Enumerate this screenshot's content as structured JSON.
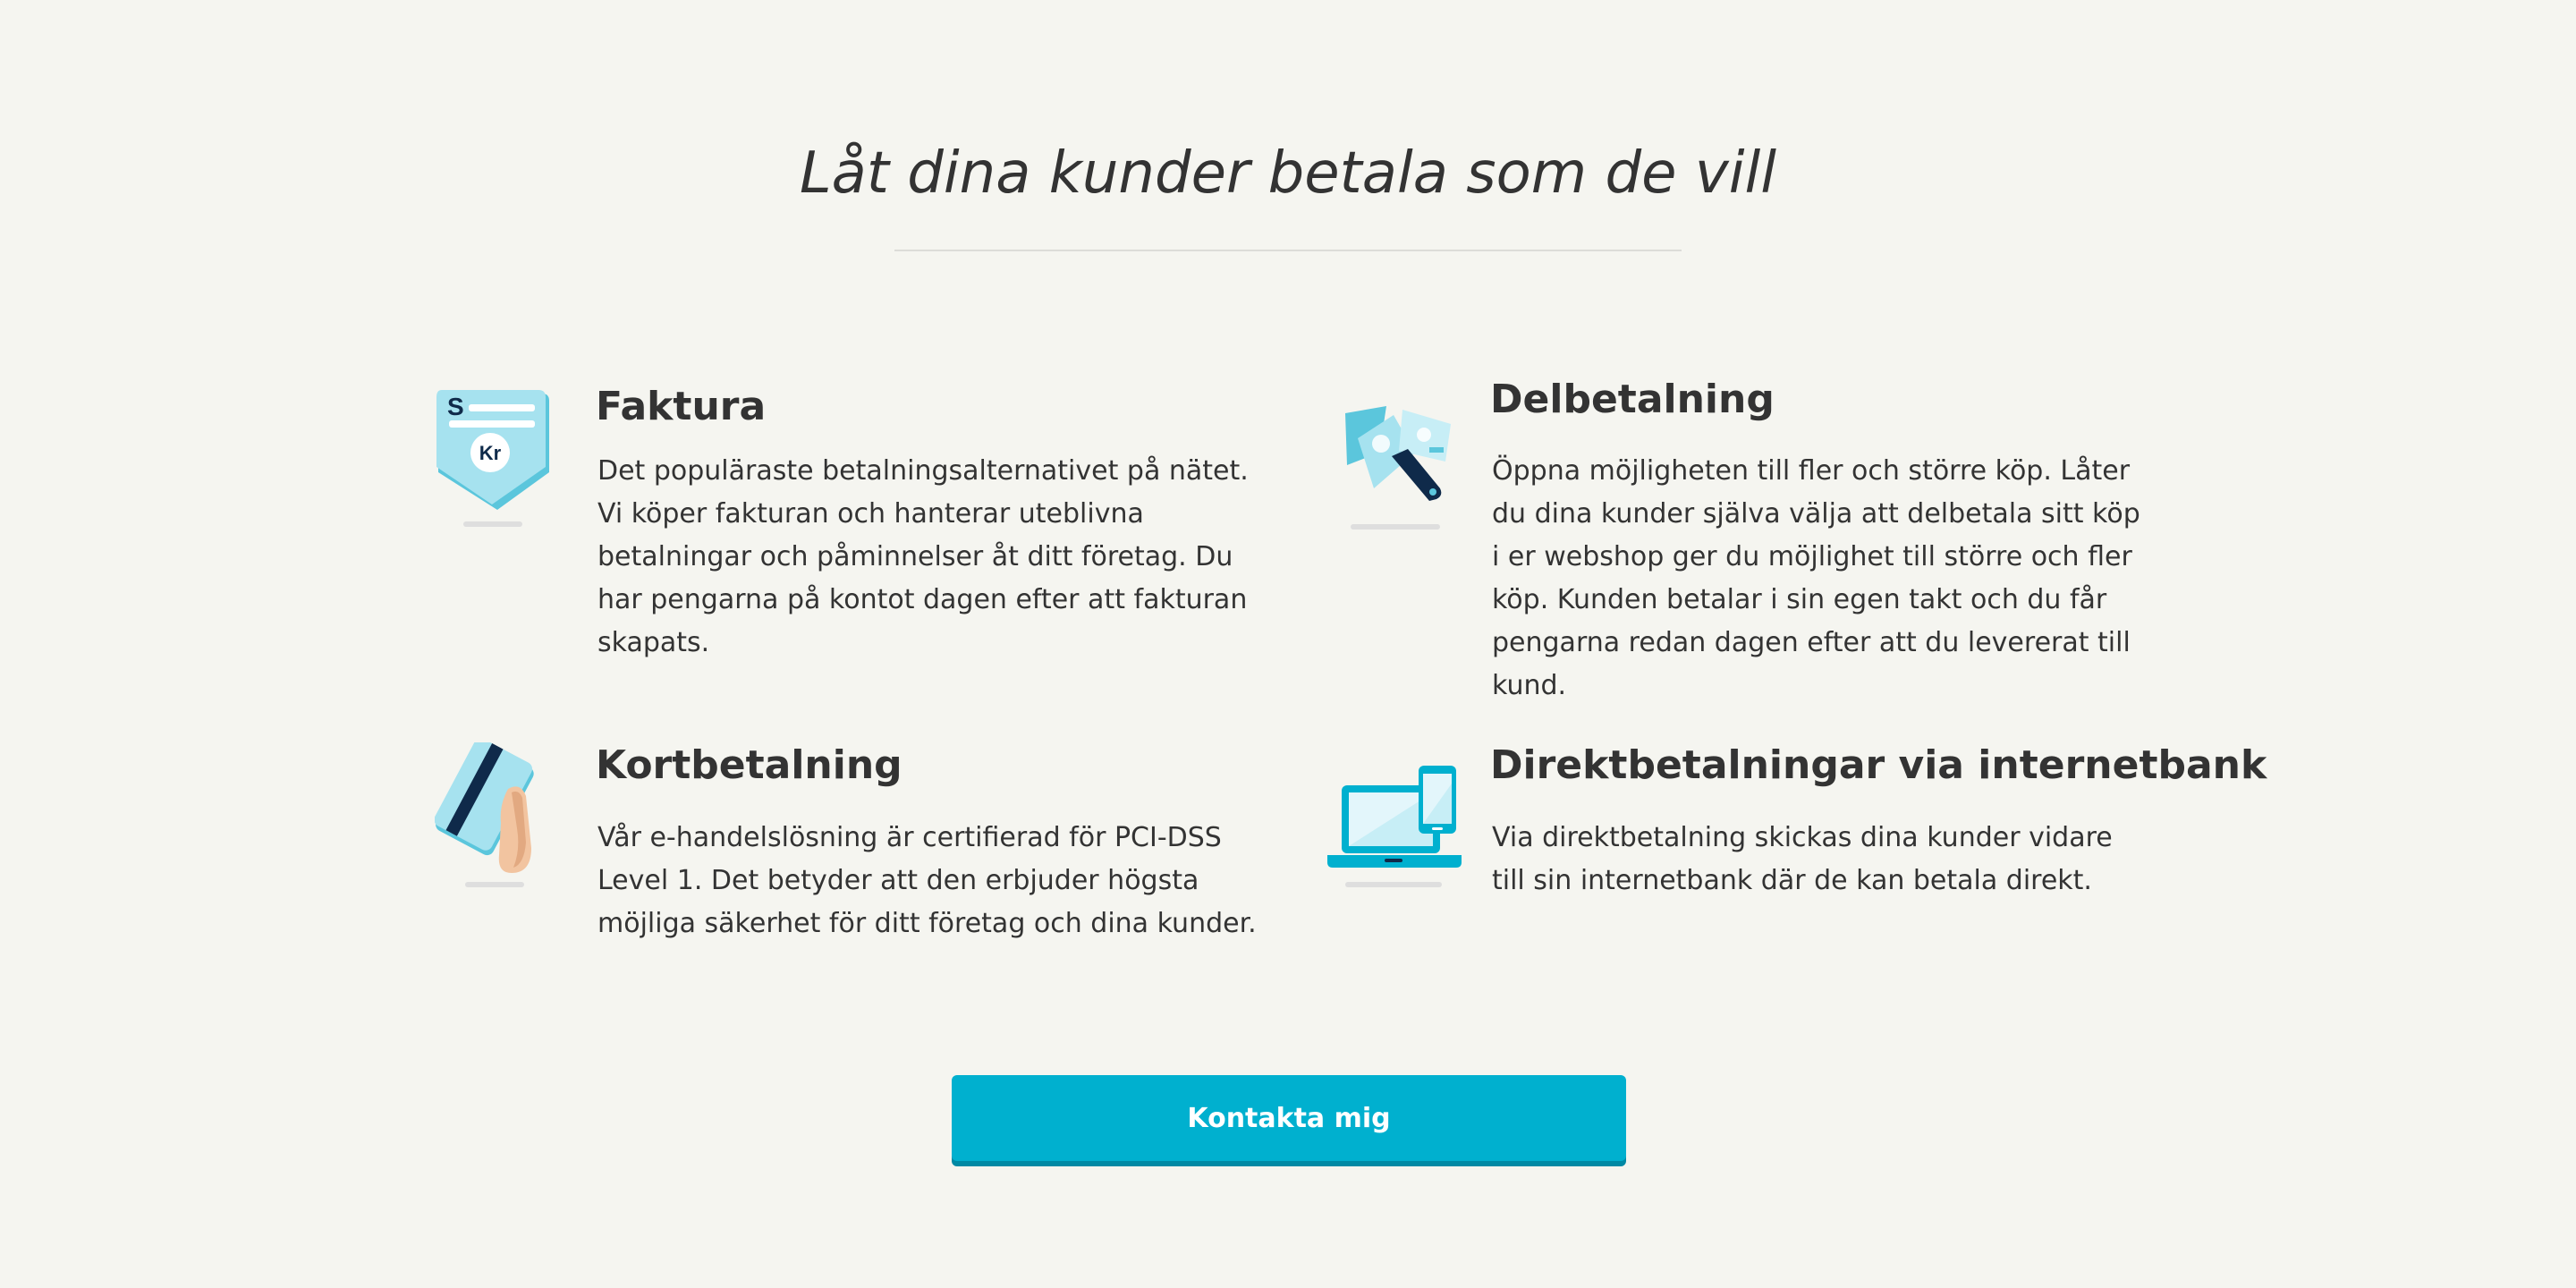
{
  "section": {
    "headline": "Låt dina kunder betala som de vill"
  },
  "features": [
    {
      "icon": "invoice-icon",
      "title": "Faktura",
      "description": "Det populäraste betalningsalternativet på nätet. Vi köper fakturan och hanterar uteblivna betalningar och påminnelser åt ditt företag. Du har pengarna på kontot dagen efter att fakturan skapats.",
      "icon_badge": "Kr",
      "icon_letter": "S"
    },
    {
      "icon": "installment-money-icon",
      "title": "Delbetalning",
      "description": "Öppna möjligheten till fler och större köp. Låter du dina kunder själva välja att delbetala sitt köp i er webshop ger du möjlighet till större och fler köp. Kunden betalar i sin egen takt och du får pengarna redan dagen efter att du levererat till kund."
    },
    {
      "icon": "card-in-hand-icon",
      "title": "Kortbetalning",
      "description": "Vår e-handelslösning är certifierad för PCI-DSS Level 1. Det betyder att den erbjuder högsta möjliga säkerhet för ditt företag och dina kunder."
    },
    {
      "icon": "laptop-phone-icon",
      "title": "Direktbetalningar via internetbank",
      "description": "Via direktbetalning skickas dina kunder vidare till sin internetbank där de kan betala direkt."
    }
  ],
  "cta": {
    "label": "Kontakta mig"
  },
  "colors": {
    "background": "#f5f5f0",
    "text": "#333333",
    "accent": "#00b0cf",
    "accent_dark": "#0089a4",
    "icon_light": "#8fd9ea",
    "icon_navy": "#0f2a4a"
  }
}
